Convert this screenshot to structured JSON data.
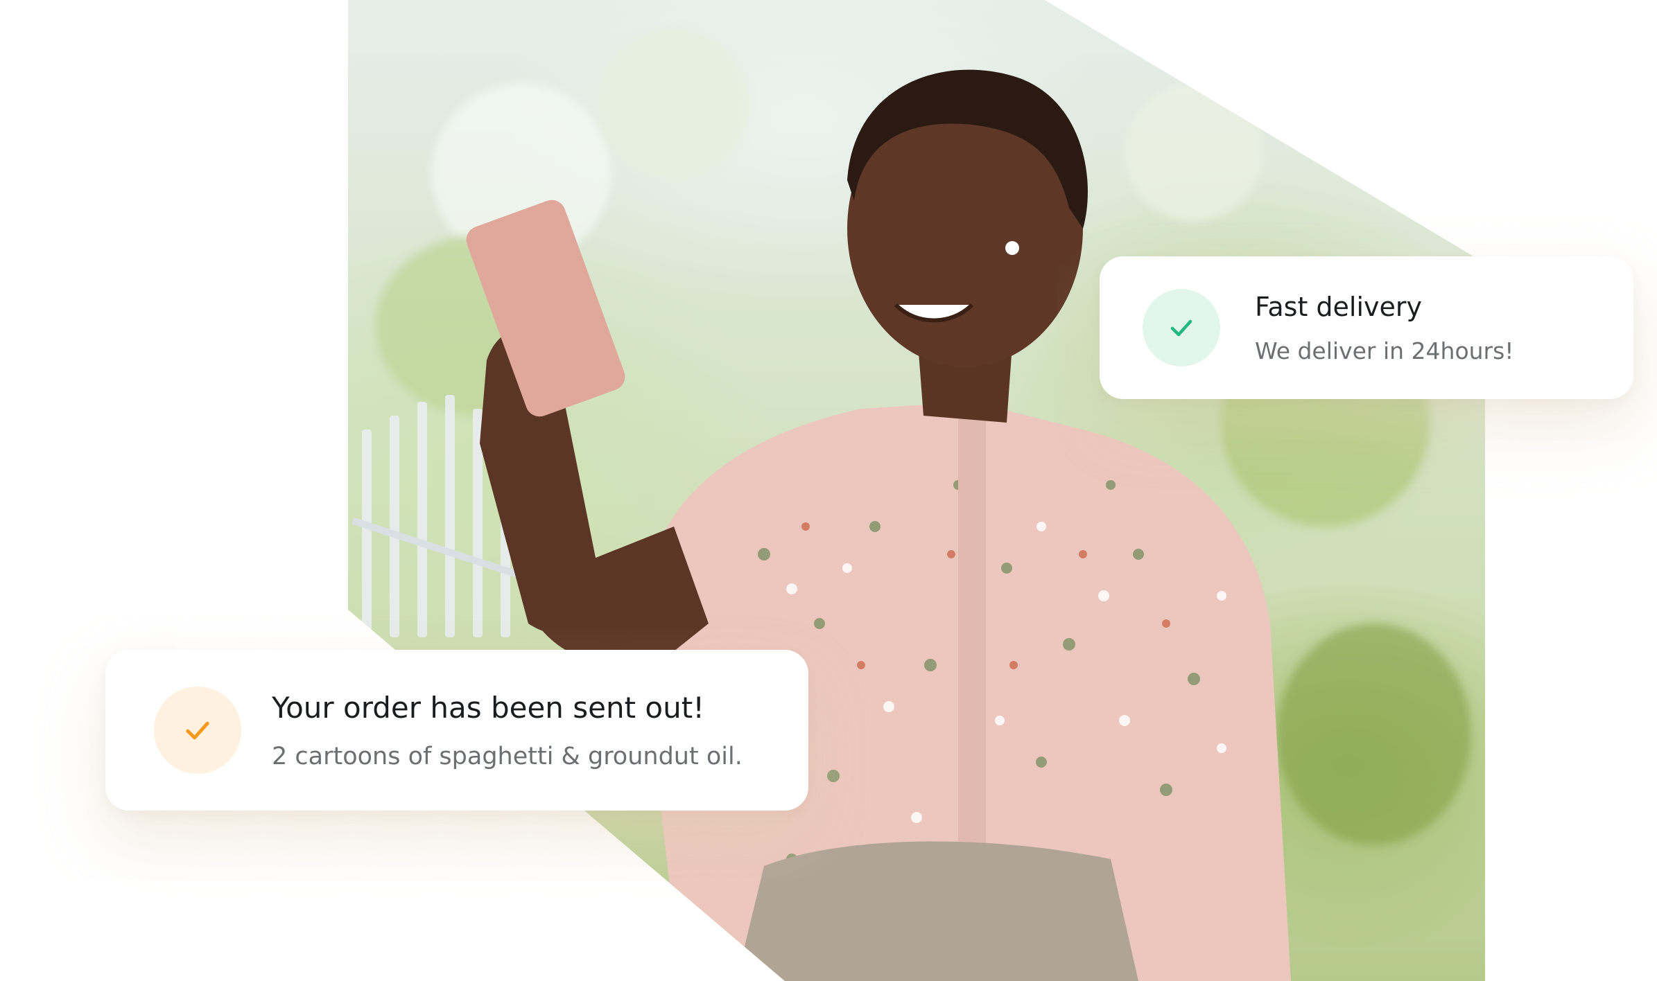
{
  "cards": {
    "delivery": {
      "title": "Fast delivery",
      "subtitle": "We deliver in 24hours!",
      "icon": "check-icon",
      "accent": "#1fb981",
      "badge_bg": "#e3f6ee"
    },
    "order": {
      "title": "Your order has been sent out!",
      "subtitle": "2 cartoons of spaghetti & groundut oil.",
      "icon": "check-icon",
      "accent": "#f39a1e",
      "badge_bg": "#fff0df"
    }
  },
  "photo": {
    "subject": "woman-with-phone-icon"
  }
}
